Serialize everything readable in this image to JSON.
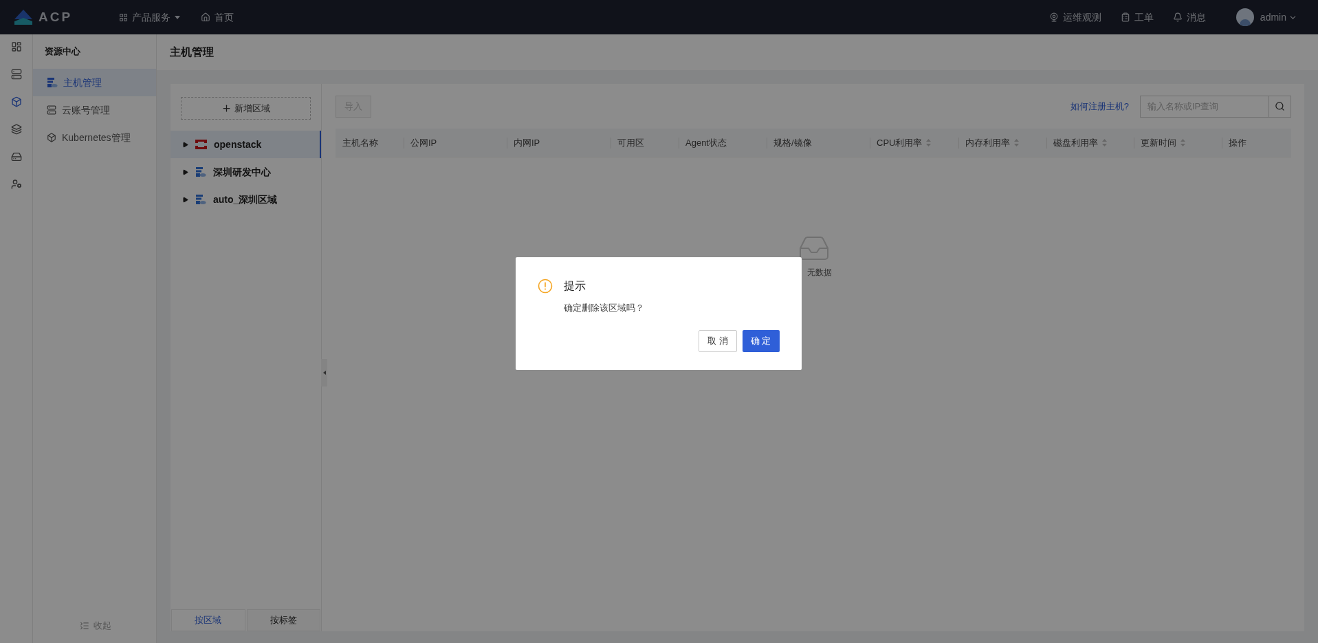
{
  "topbar": {
    "logo": "ACP",
    "nav": [
      {
        "label": "产品服务",
        "kind": "dropdown"
      },
      {
        "label": "首页",
        "kind": "home"
      }
    ],
    "actions": [
      {
        "label": "运维观测",
        "kind": "observe"
      },
      {
        "label": "工单",
        "kind": "ticket"
      },
      {
        "label": "消息",
        "kind": "message"
      }
    ],
    "user": "admin"
  },
  "rail": [
    {
      "kind": "dashboard",
      "selected": false
    },
    {
      "kind": "server",
      "selected": false
    },
    {
      "kind": "cube",
      "selected": true
    },
    {
      "kind": "layers",
      "selected": false
    },
    {
      "kind": "host",
      "selected": false
    },
    {
      "kind": "user",
      "selected": false
    }
  ],
  "sidebar": {
    "title": "资源中心",
    "items": [
      {
        "label": "主机管理",
        "kind": "host",
        "selected": true
      },
      {
        "label": "云账号管理",
        "kind": "account",
        "selected": false
      },
      {
        "label": "Kubernetes管理",
        "kind": "cube",
        "selected": false
      }
    ],
    "collapse": "收起"
  },
  "page_title": "主机管理",
  "tree": {
    "add_button": "新增区域",
    "items": [
      {
        "label": "openstack",
        "kind": "openstack",
        "selected": true
      },
      {
        "label": "深圳研发中心",
        "kind": "region",
        "selected": false
      },
      {
        "label": "auto_深圳区域",
        "kind": "region",
        "selected": false
      }
    ],
    "tabs": [
      {
        "label": "按区域",
        "selected": true
      },
      {
        "label": "按标签",
        "selected": false
      }
    ]
  },
  "toolbar": {
    "import_button": {
      "label": "导入",
      "disabled": true
    },
    "help_link": "如何注册主机?",
    "search": {
      "placeholder": "输入名称或IP查询"
    }
  },
  "table": {
    "columns": [
      {
        "label": "主机名称",
        "sortable": false
      },
      {
        "label": "公网IP",
        "sortable": false
      },
      {
        "label": "内网IP",
        "sortable": false
      },
      {
        "label": "可用区",
        "sortable": false
      },
      {
        "label": "Agent状态",
        "sortable": false
      },
      {
        "label": "规格/镜像",
        "sortable": false
      },
      {
        "label": "CPU利用率",
        "sortable": true
      },
      {
        "label": "内存利用率",
        "sortable": true
      },
      {
        "label": "磁盘利用率",
        "sortable": true
      },
      {
        "label": "更新时间",
        "sortable": true
      },
      {
        "label": "操作",
        "sortable": false
      }
    ],
    "empty_text": "无数据"
  },
  "dialog": {
    "title": "提示",
    "message": "确定删除该区域吗？",
    "buttons": [
      {
        "label": "取 消",
        "kind": "cancel"
      },
      {
        "label": "确 定",
        "kind": "primary"
      }
    ]
  }
}
